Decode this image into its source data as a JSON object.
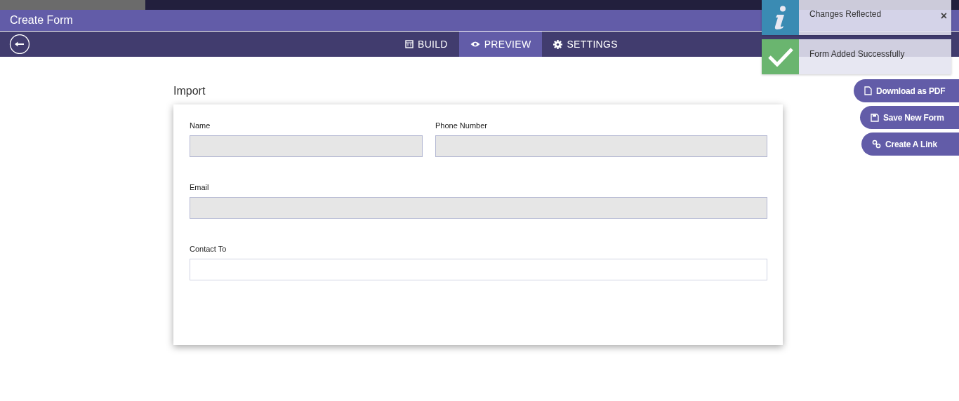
{
  "window": {
    "title": "Create Form"
  },
  "tabs": [
    {
      "label": "BUILD",
      "selected": false
    },
    {
      "label": "PREVIEW",
      "selected": true
    },
    {
      "label": "SETTINGS",
      "selected": false
    }
  ],
  "form": {
    "title": "Import",
    "fields": [
      {
        "label": "Name",
        "disabled": true
      },
      {
        "label": "Phone Number",
        "disabled": true
      },
      {
        "label": "Email",
        "disabled": true
      },
      {
        "label": "Contact To",
        "disabled": false
      }
    ]
  },
  "actions": [
    {
      "label": "Download as PDF"
    },
    {
      "label": "Save New Form"
    },
    {
      "label": "Create A Link"
    }
  ],
  "toasts": [
    {
      "kind": "info",
      "message": "Changes Reflected",
      "close": "×"
    },
    {
      "kind": "success",
      "message": "Form Added Successfully"
    }
  ]
}
